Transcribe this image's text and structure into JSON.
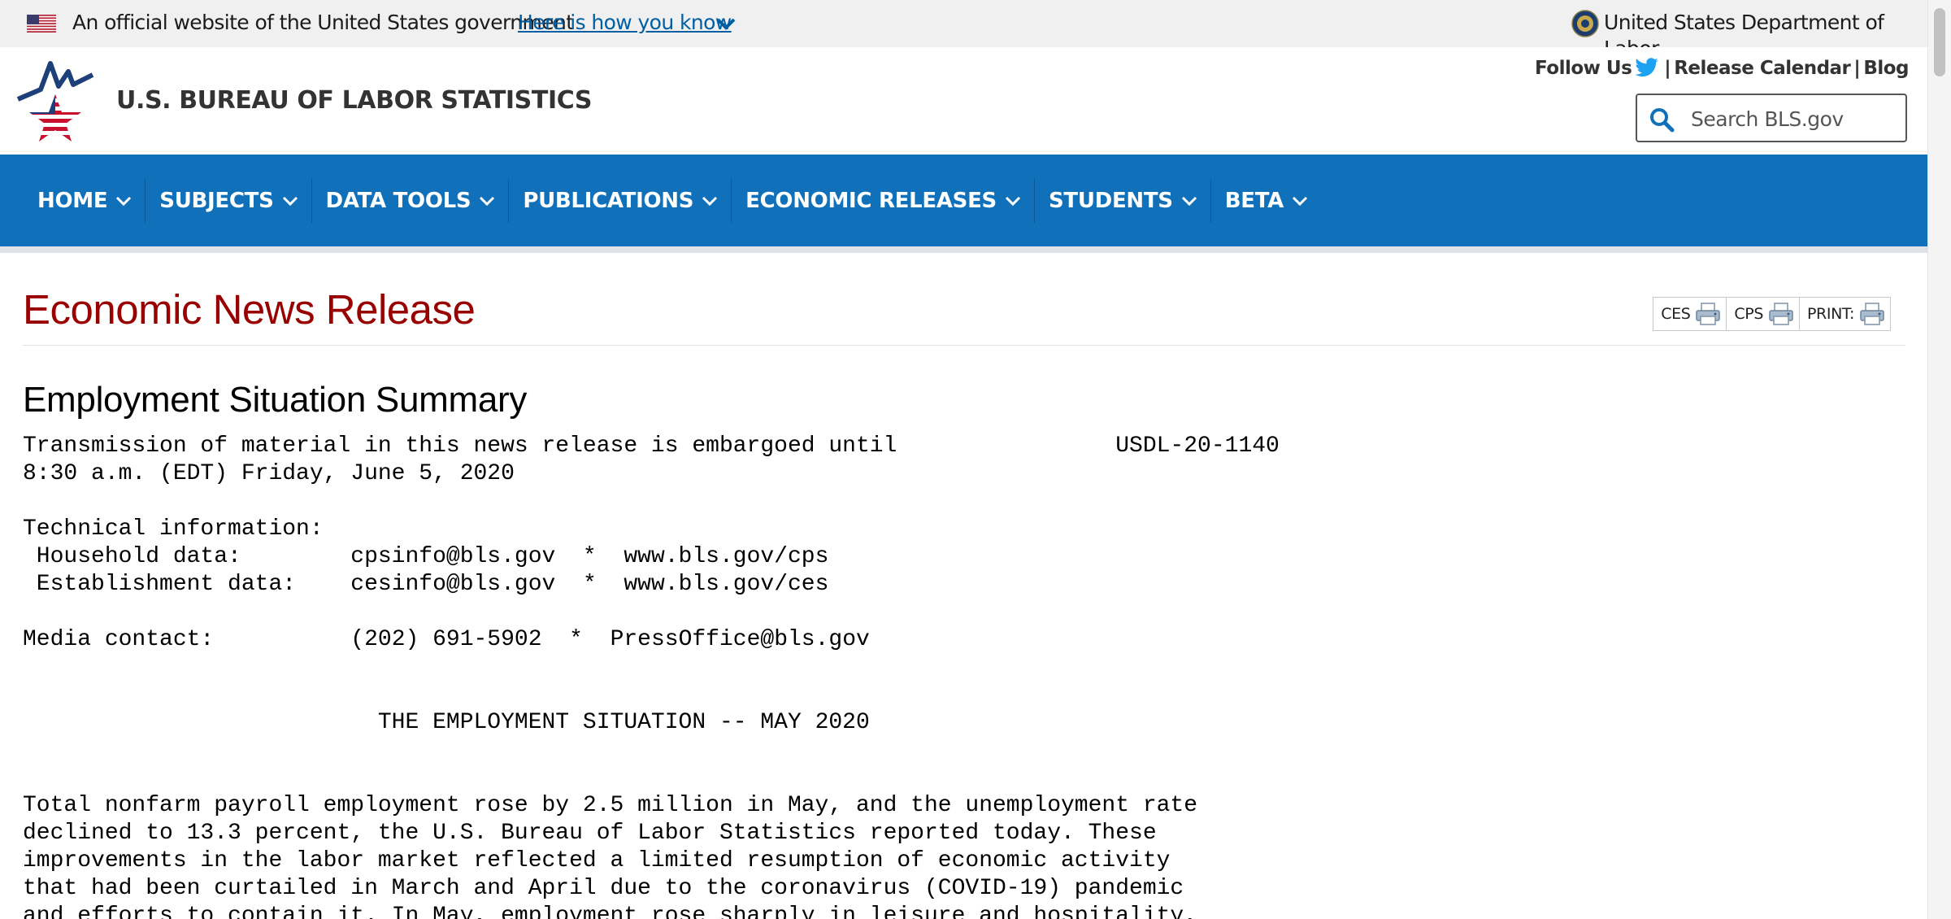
{
  "gov_banner": {
    "official_text": "An official website of the United States government",
    "how_you_know": "Here is how you know",
    "department": "United States Department of Labor"
  },
  "header": {
    "agency_name": "U.S. BUREAU OF LABOR STATISTICS",
    "follow_us": "Follow Us",
    "separator": "|",
    "release_calendar": "Release Calendar",
    "blog": "Blog",
    "search_placeholder": "Search BLS.gov"
  },
  "nav": {
    "items": [
      {
        "label": "HOME"
      },
      {
        "label": "SUBJECTS"
      },
      {
        "label": "DATA TOOLS"
      },
      {
        "label": "PUBLICATIONS"
      },
      {
        "label": "ECONOMIC RELEASES"
      },
      {
        "label": "STUDENTS"
      },
      {
        "label": "BETA"
      }
    ]
  },
  "release": {
    "page_title": "Economic News Release",
    "print_tools": [
      {
        "label": "CES"
      },
      {
        "label": "CPS"
      },
      {
        "label": "PRINT:"
      }
    ],
    "summary_heading": "Employment Situation Summary",
    "embargo_line1": "Transmission of material in this news release is embargoed until",
    "release_number": "USDL-20-1140",
    "embargo_line2": "8:30 a.m. (EDT) Friday, June 5, 2020",
    "tech_info_label": "Technical information:",
    "household_label": " Household data:",
    "household_email": "cpsinfo@bls.gov",
    "household_url": "www.bls.gov/cps",
    "establishment_label": " Establishment data:",
    "establishment_email": "cesinfo@bls.gov",
    "establishment_url": "www.bls.gov/ces",
    "media_label": "Media contact:",
    "media_phone": "(202) 691-5902",
    "media_email": "PressOffice@bls.gov",
    "bullet": "*",
    "situation_heading": "THE EMPLOYMENT SITUATION -- MAY 2020",
    "body_lines": [
      "Total nonfarm payroll employment rose by 2.5 million in May, and the unemployment rate",
      "declined to 13.3 percent, the U.S. Bureau of Labor Statistics reported today. These",
      "improvements in the labor market reflected a limited resumption of economic activity",
      "that had been curtailed in March and April due to the coronavirus (COVID-19) pandemic",
      "and efforts to contain it. In May, employment rose sharply in leisure and hospitality,"
    ]
  }
}
